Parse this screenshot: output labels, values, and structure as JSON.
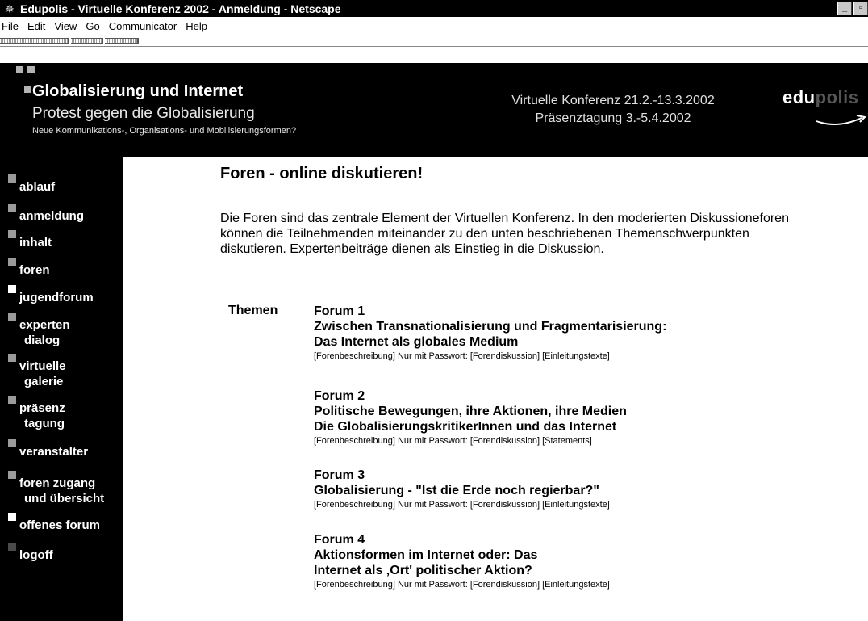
{
  "window": {
    "title": "Edupolis - Virtuelle Konferenz 2002 - Anmeldung - Netscape",
    "icon": "netscape-icon"
  },
  "menubar": {
    "items": [
      {
        "mnemonic": "F",
        "rest": "ile"
      },
      {
        "mnemonic": "E",
        "rest": "dit"
      },
      {
        "mnemonic": "V",
        "rest": "iew"
      },
      {
        "mnemonic": "G",
        "rest": "o"
      },
      {
        "mnemonic": "C",
        "rest": "ommunicator"
      },
      {
        "mnemonic": "H",
        "rest": "elp"
      }
    ]
  },
  "banner": {
    "title": "Globalisierung und Internet",
    "subtitle": "Protest gegen die Globalisierung",
    "tagline": "Neue Kommunikations-, Organisations- und Mobilisierungsformen?",
    "conference_line1": "Virtuelle Konferenz 21.2.-13.3.2002",
    "conference_line2": "Präsenztagung 3.-5.4.2002",
    "logo_part1": "edu",
    "logo_part2": "polis"
  },
  "sidebar": {
    "items": [
      {
        "lines": [
          "ablauf"
        ],
        "bullet": "grey"
      },
      {
        "lines": [
          "anmeldung"
        ],
        "bullet": "grey"
      },
      {
        "lines": [
          "inhalt"
        ],
        "bullet": "grey"
      },
      {
        "lines": [
          "foren"
        ],
        "bullet": "grey"
      },
      {
        "lines": [
          "jugendforum"
        ],
        "bullet": "white"
      },
      {
        "lines": [
          "experten",
          "dialog"
        ],
        "bullet": "grey"
      },
      {
        "lines": [
          "virtuelle",
          "galerie"
        ],
        "bullet": "grey"
      },
      {
        "lines": [
          "präsenz",
          "tagung"
        ],
        "bullet": "grey"
      },
      {
        "lines": [
          "veranstalter"
        ],
        "bullet": "grey"
      },
      {
        "lines": [
          "foren zugang",
          "und übersicht"
        ],
        "bullet": "grey"
      },
      {
        "lines": [
          "offenes forum"
        ],
        "bullet": "white"
      },
      {
        "lines": [
          "logoff"
        ],
        "bullet": "dark"
      }
    ]
  },
  "main": {
    "title": "Foren - online diskutieren!",
    "intro": "Die Foren sind das zentrale Element der Virtuellen Konferenz. In den moderierten Diskussioneforen können die Teilnehmenden miteinander zu den unten beschriebenen Themenschwerpunkten diskutieren. Expertenbeiträge dienen als Einstieg in die Diskussion.",
    "themen_label": "Themen",
    "forums": [
      {
        "lines": [
          "Forum 1",
          "Zwischen Transnationalisierung und Fragmentarisierung:",
          "Das Internet als globales Medium"
        ],
        "link1": "[Forenbeschreibung]",
        "password_text": " Nur mit Passwort: ",
        "link2": "[Forendiskussion]",
        "link3": "[Einleitungstexte]"
      },
      {
        "lines": [
          "Forum 2",
          "Politische Bewegungen, ihre Aktionen, ihre Medien",
          "Die GlobalisierungskritikerInnen und das Internet"
        ],
        "link1": "[Forenbeschreibung]",
        "password_text": " Nur mit Passwort: ",
        "link2": "[Forendiskussion]",
        "link3": "[Statements]"
      },
      {
        "lines": [
          "Forum 3",
          "Globalisierung - \"Ist die Erde noch regierbar?\""
        ],
        "link1": "[Forenbeschreibung]",
        "password_text": " Nur mit Passwort: ",
        "link2": "[Forendiskussion]",
        "link3": "[Einleitungstexte]"
      },
      {
        "lines": [
          "Forum 4",
          "Aktionsformen im Internet oder: Das",
          "Internet als ‚Ort' politischer Aktion?"
        ],
        "link1": "[Forenbeschreibung]",
        "password_text": " Nur mit Passwort: ",
        "link2": "[Forendiskussion]",
        "link3": "[Einleitungstexte]"
      }
    ]
  }
}
